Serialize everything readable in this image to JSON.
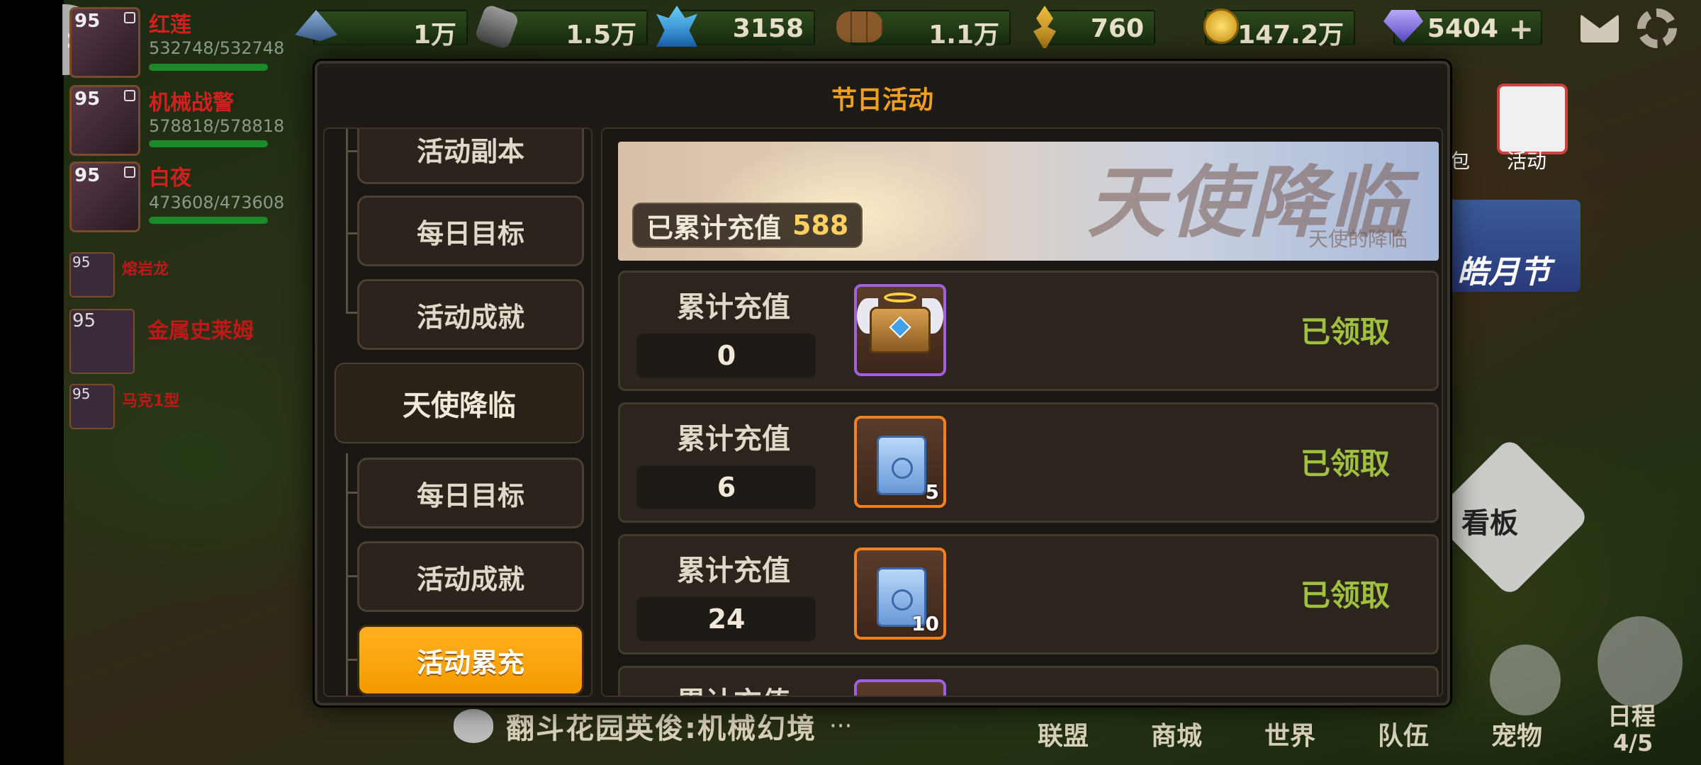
{
  "resources": {
    "stone": "1万",
    "ore": "1.5万",
    "crystal": "3158",
    "wood": "1.1万",
    "wheat": "760",
    "gold": "147.2万",
    "diamond": "5404",
    "plus": "+"
  },
  "party": [
    {
      "level": "95",
      "name": "红莲",
      "hp": "532748/532748"
    },
    {
      "level": "95",
      "name": "机械战警",
      "hp": "578818/578818"
    },
    {
      "level": "95",
      "name": "白夜",
      "hp": "473608/473608"
    }
  ],
  "minions": [
    {
      "level": "95",
      "name": "熔岩龙"
    },
    {
      "level": "95",
      "name": "金属史莱姆"
    },
    {
      "level": "95",
      "name": "马克1型"
    }
  ],
  "right_panel": {
    "activity_label": "活动",
    "bag_partial": "包",
    "festival_label": "皓月节",
    "board_label": "看板"
  },
  "bottom": {
    "chat_text": "翻斗花园英俊:机械幻境",
    "chat_more": "···",
    "nav": [
      "联盟",
      "商城",
      "世界",
      "队伍",
      "宠物"
    ],
    "schedule_label": "日程",
    "schedule_count": "4/5"
  },
  "modal": {
    "title": "节日活动",
    "sidebar": {
      "items_top": [
        "活动副本",
        "每日目标",
        "活动成就"
      ],
      "group": "天使降临",
      "items_bottom": [
        "每日目标",
        "活动成就",
        "活动累充"
      ],
      "active": "活动累充"
    },
    "banner": {
      "title": "天使降临",
      "subtitle": "天使的降临",
      "total_label": "已累计充值",
      "total_value": "588"
    },
    "rewards": [
      {
        "label": "累计充值",
        "threshold": "0",
        "item": "angel-chest",
        "rarity": "purple",
        "qty": "",
        "status": "已领取"
      },
      {
        "label": "累计充值",
        "threshold": "6",
        "item": "scroll",
        "rarity": "orange",
        "qty": "5",
        "status": "已领取"
      },
      {
        "label": "累计充值",
        "threshold": "24",
        "item": "scroll",
        "rarity": "orange",
        "qty": "10",
        "status": "已领取"
      },
      {
        "label": "累计充值",
        "threshold": "",
        "item": "unknown",
        "rarity": "purple",
        "qty": "",
        "status": ""
      }
    ]
  },
  "colors": {
    "accent": "#f59a00",
    "title": "#f0a020",
    "claimed": "#a0c040",
    "purple_rarity": "#a060e0",
    "orange_rarity": "#f08020"
  }
}
